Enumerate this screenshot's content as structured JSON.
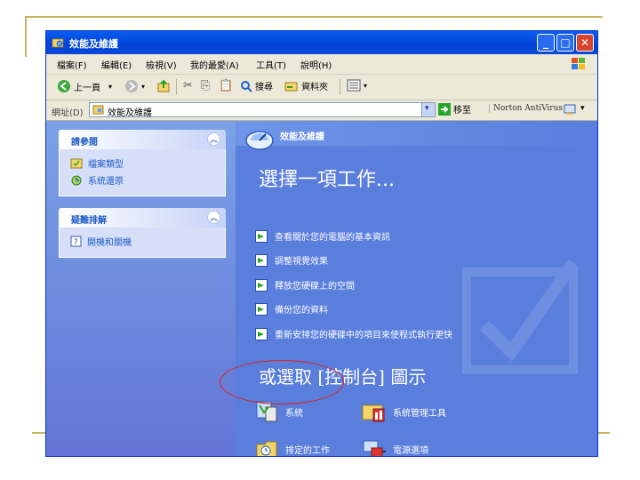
{
  "window": {
    "title": "效能及維護",
    "buttons": {
      "minimize": "_",
      "maximize": "□",
      "close": "✕"
    }
  },
  "menubar": {
    "items": [
      "檔案(F)",
      "編輯(E)",
      "檢視(V)",
      "我的最愛(A)",
      "工具(T)",
      "說明(H)"
    ]
  },
  "toolbar": {
    "back": "上一頁",
    "search": "搜尋",
    "folders": "資料夾"
  },
  "address": {
    "label": "網址(D)",
    "value": "效能及維護",
    "go": "移至",
    "norton": "Norton AntiVirus"
  },
  "sidebar": {
    "panels": [
      {
        "title": "請參閱",
        "items": [
          {
            "label": "檔案類型",
            "icon": "file-types-icon"
          },
          {
            "label": "系統還原",
            "icon": "system-restore-icon"
          }
        ]
      },
      {
        "title": "疑難排解",
        "items": [
          {
            "label": "開機和關機",
            "icon": "help-icon"
          }
        ]
      }
    ]
  },
  "main": {
    "header": "效能及維護",
    "pick_task": "選擇一項工作...",
    "tasks": [
      "查看關於您的電腦的基本資訊",
      "調整視覺效果",
      "釋放您硬碟上的空間",
      "備份您的資料",
      "重新安排您的硬碟中的項目來使程式執行更快"
    ],
    "or_pick": "或選取 [控制台] 圖示",
    "icons": [
      {
        "label": "系統",
        "icon": "system-icon"
      },
      {
        "label": "系統管理工具",
        "icon": "admin-tools-icon"
      },
      {
        "label": "排定的工作",
        "icon": "scheduled-tasks-icon"
      },
      {
        "label": "電源選項",
        "icon": "power-options-icon"
      }
    ]
  },
  "colors": {
    "titlebar": "#0a5df0",
    "main_bg": "#5a7edc",
    "panel_link": "#215dc6",
    "highlight_ellipse": "#e0201c"
  }
}
